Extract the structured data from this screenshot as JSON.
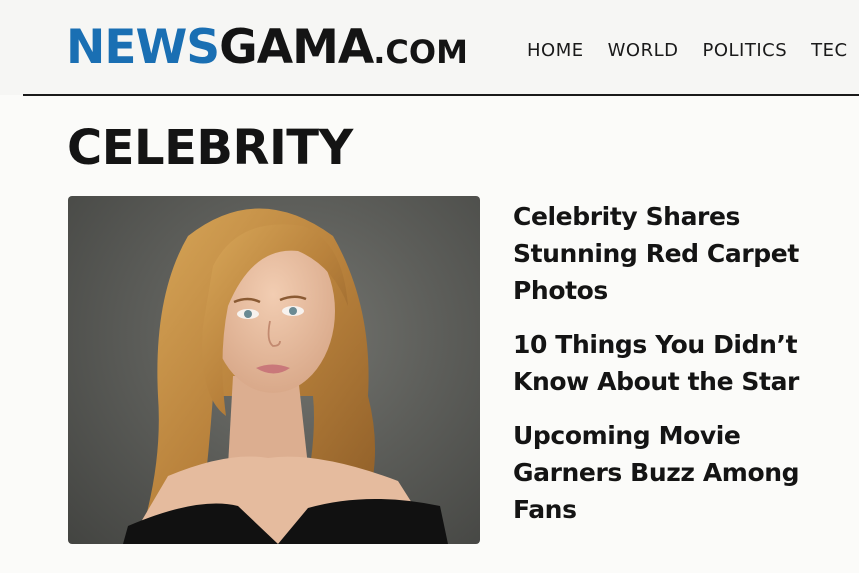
{
  "site": {
    "logo_part1": "NEWS",
    "logo_part2": "GAMA",
    "logo_suffix": ".COM",
    "brand_color": "#1a6fb3"
  },
  "nav": {
    "items": [
      "HOME",
      "WORLD",
      "POLITICS",
      "TEC"
    ]
  },
  "section": {
    "title": "CELEBRITY"
  },
  "featured_image": {
    "icon": "portrait-photo"
  },
  "headlines": [
    "Celebrity Shares Stunning Red Carpet Photos",
    "10 Things You Didn’t Know About the Star",
    "Upcoming Movie Garners Buzz Among Fans"
  ]
}
